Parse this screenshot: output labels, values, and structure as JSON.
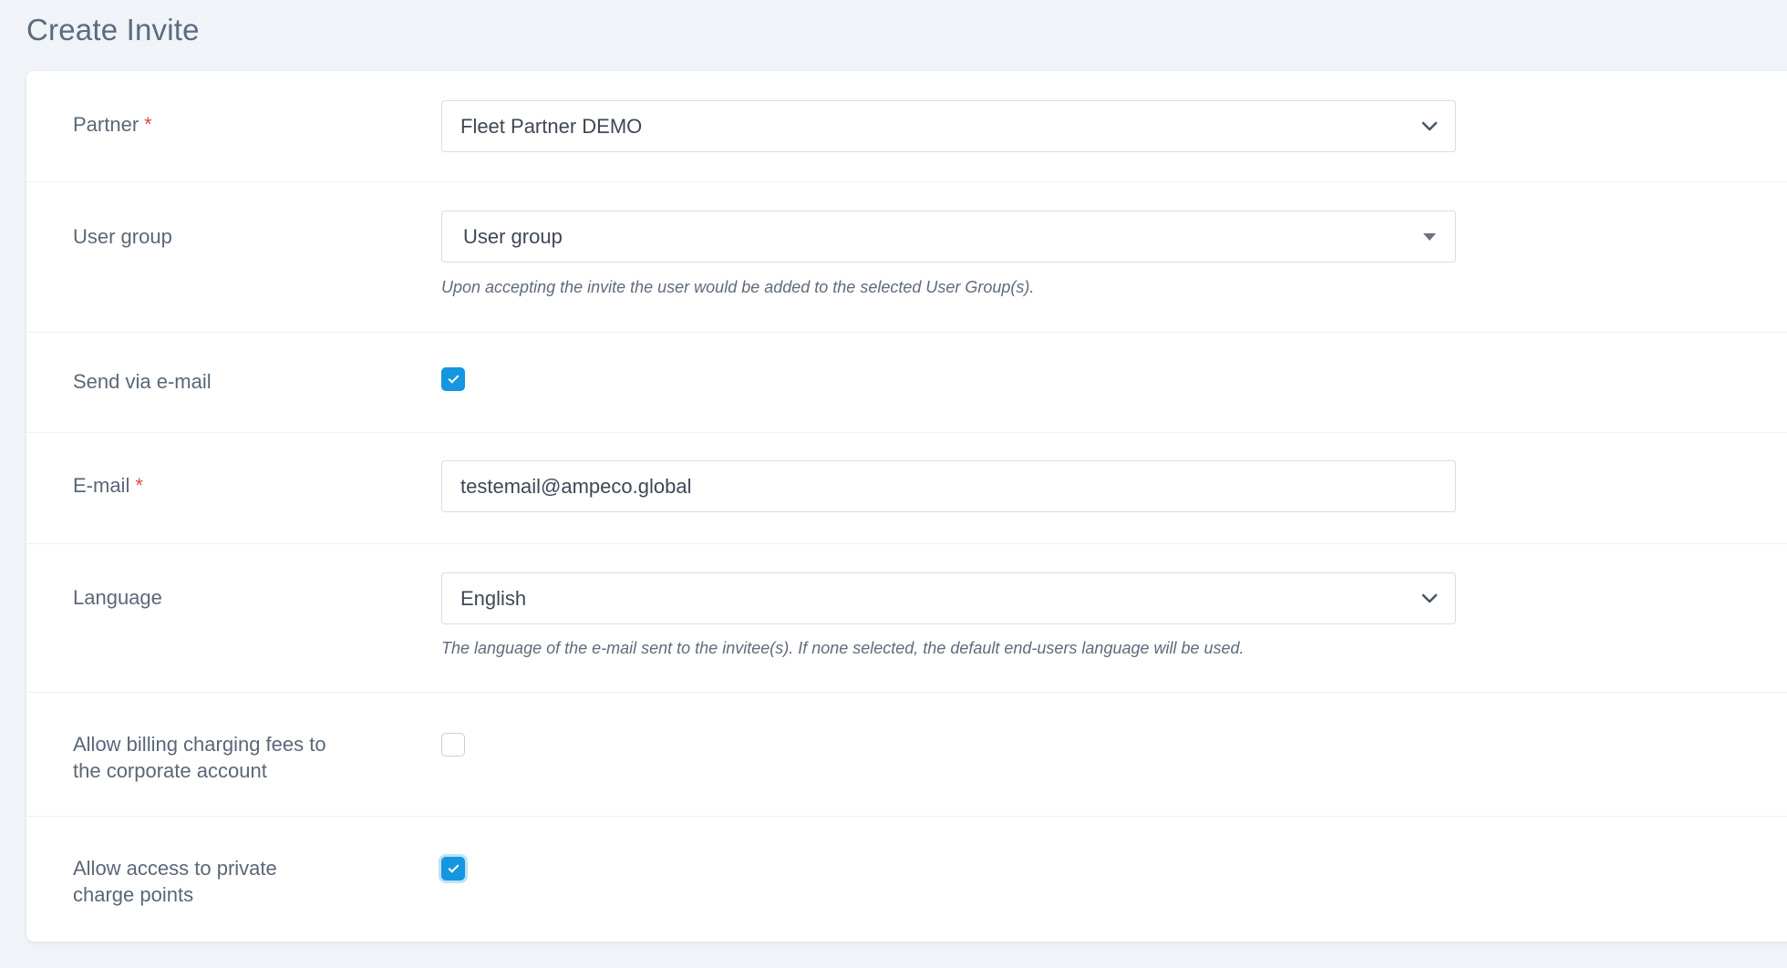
{
  "page": {
    "title": "Create Invite"
  },
  "form": {
    "partner": {
      "label": "Partner",
      "required_mark": "*",
      "value": "Fleet Partner DEMO",
      "icon": "chevron-down-icon"
    },
    "user_group": {
      "label": "User group",
      "value": "User group",
      "icon": "caret-down-icon",
      "help": "Upon accepting the invite the user would be added to the selected User Group(s)."
    },
    "send_via_email": {
      "label": "Send via e-mail",
      "checked": true
    },
    "email": {
      "label": "E-mail",
      "required_mark": "*",
      "value": "testemail@ampeco.global"
    },
    "language": {
      "label": "Language",
      "value": "English",
      "icon": "chevron-down-icon",
      "help": "The language of the e-mail sent to the invitee(s). If none selected, the default end-users language will be used."
    },
    "allow_billing": {
      "label_line1": "Allow billing charging fees to",
      "label_line2": "the corporate account",
      "checked": false
    },
    "allow_private": {
      "label_line1": "Allow access to private",
      "label_line2": "charge points",
      "checked": true
    }
  },
  "colors": {
    "accent": "#1596e0",
    "required": "#e04848",
    "background": "#f0f3f7"
  }
}
